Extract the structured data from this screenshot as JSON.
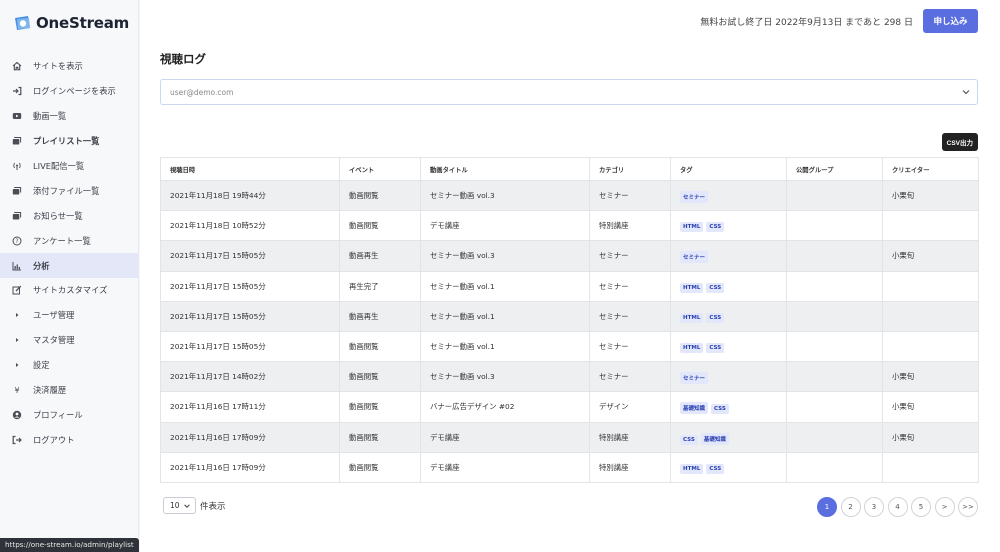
{
  "app": {
    "logo_text": "OneStream"
  },
  "sidebar": {
    "items": [
      {
        "label": "サイトを表示",
        "icon": "home-icon"
      },
      {
        "label": "ログインページを表示",
        "icon": "sign-in-icon"
      },
      {
        "label": "動画一覧",
        "icon": "video-icon"
      },
      {
        "label": "プレイリスト一覧",
        "icon": "playlist-icon",
        "bold": true
      },
      {
        "label": "LIVE配信一覧",
        "icon": "broadcast-icon"
      },
      {
        "label": "添付ファイル一覧",
        "icon": "attachment-icon"
      },
      {
        "label": "お知らせ一覧",
        "icon": "news-icon"
      },
      {
        "label": "アンケート一覧",
        "icon": "question-icon"
      },
      {
        "label": "分析",
        "icon": "chart-icon",
        "active": true,
        "bold": true
      },
      {
        "label": "サイトカスタマイズ",
        "icon": "edit-icon"
      },
      {
        "label": "ユーザ管理",
        "icon": "caret-right-icon"
      },
      {
        "label": "マスタ管理",
        "icon": "caret-right-icon"
      },
      {
        "label": "設定",
        "icon": "caret-right-icon"
      },
      {
        "label": "決済履歴",
        "icon": "yen-icon"
      },
      {
        "label": "プロフィール",
        "icon": "user-circle-icon"
      },
      {
        "label": "ログアウト",
        "icon": "sign-out-icon"
      }
    ]
  },
  "header": {
    "trial_text": "無料お試し終了日 2022年9月13日 まであと 298 日",
    "apply_label": "申し込み"
  },
  "page": {
    "title": "視聴ログ",
    "user_select_value": "user@demo.com",
    "csv_label": "CSV出力"
  },
  "table": {
    "headers": [
      "視聴日時",
      "イベント",
      "動画タイトル",
      "カテゴリ",
      "タグ",
      "公開グループ",
      "クリエイター"
    ],
    "rows": [
      {
        "datetime": "2021年11月18日 19時44分",
        "event": "動画閲覧",
        "title": "セミナー動画 vol.3",
        "category": "セミナー",
        "tags": [
          "セミナー"
        ],
        "group": "",
        "creator": "小栗旬"
      },
      {
        "datetime": "2021年11月18日 10時52分",
        "event": "動画閲覧",
        "title": "デモ講座",
        "category": "特別講座",
        "tags": [
          "HTML",
          "CSS"
        ],
        "group": "",
        "creator": ""
      },
      {
        "datetime": "2021年11月17日 15時05分",
        "event": "動画再生",
        "title": "セミナー動画 vol.3",
        "category": "セミナー",
        "tags": [
          "セミナー"
        ],
        "group": "",
        "creator": "小栗旬"
      },
      {
        "datetime": "2021年11月17日 15時05分",
        "event": "再生完了",
        "title": "セミナー動画 vol.1",
        "category": "セミナー",
        "tags": [
          "HTML",
          "CSS"
        ],
        "group": "",
        "creator": ""
      },
      {
        "datetime": "2021年11月17日 15時05分",
        "event": "動画再生",
        "title": "セミナー動画 vol.1",
        "category": "セミナー",
        "tags": [
          "HTML",
          "CSS"
        ],
        "group": "",
        "creator": ""
      },
      {
        "datetime": "2021年11月17日 15時05分",
        "event": "動画閲覧",
        "title": "セミナー動画 vol.1",
        "category": "セミナー",
        "tags": [
          "HTML",
          "CSS"
        ],
        "group": "",
        "creator": ""
      },
      {
        "datetime": "2021年11月17日 14時02分",
        "event": "動画閲覧",
        "title": "セミナー動画 vol.3",
        "category": "セミナー",
        "tags": [
          "セミナー"
        ],
        "group": "",
        "creator": "小栗旬"
      },
      {
        "datetime": "2021年11月16日 17時11分",
        "event": "動画閲覧",
        "title": "バナー広告デザイン #02",
        "category": "デザイン",
        "tags": [
          "基礎知識",
          "CSS"
        ],
        "group": "",
        "creator": "小栗旬"
      },
      {
        "datetime": "2021年11月16日 17時09分",
        "event": "動画閲覧",
        "title": "デモ講座",
        "category": "特別講座",
        "tags": [
          "CSS",
          "基礎知識"
        ],
        "group": "",
        "creator": "小栗旬"
      },
      {
        "datetime": "2021年11月16日 17時09分",
        "event": "動画閲覧",
        "title": "デモ講座",
        "category": "特別講座",
        "tags": [
          "HTML",
          "CSS"
        ],
        "group": "",
        "creator": ""
      }
    ]
  },
  "pagination": {
    "per_page_value": "10",
    "per_page_label": "件表示",
    "pages": [
      "1",
      "2",
      "3",
      "4",
      "5",
      ">",
      ">>"
    ],
    "current": "1"
  },
  "statusbar": {
    "url": "https://one-stream.io/admin/playlist"
  },
  "colors": {
    "accent": "#5a6ee0",
    "active_nav": "#e4e7f7",
    "tag_bg": "#e2e7fb",
    "tag_text": "#2a3fb0"
  }
}
